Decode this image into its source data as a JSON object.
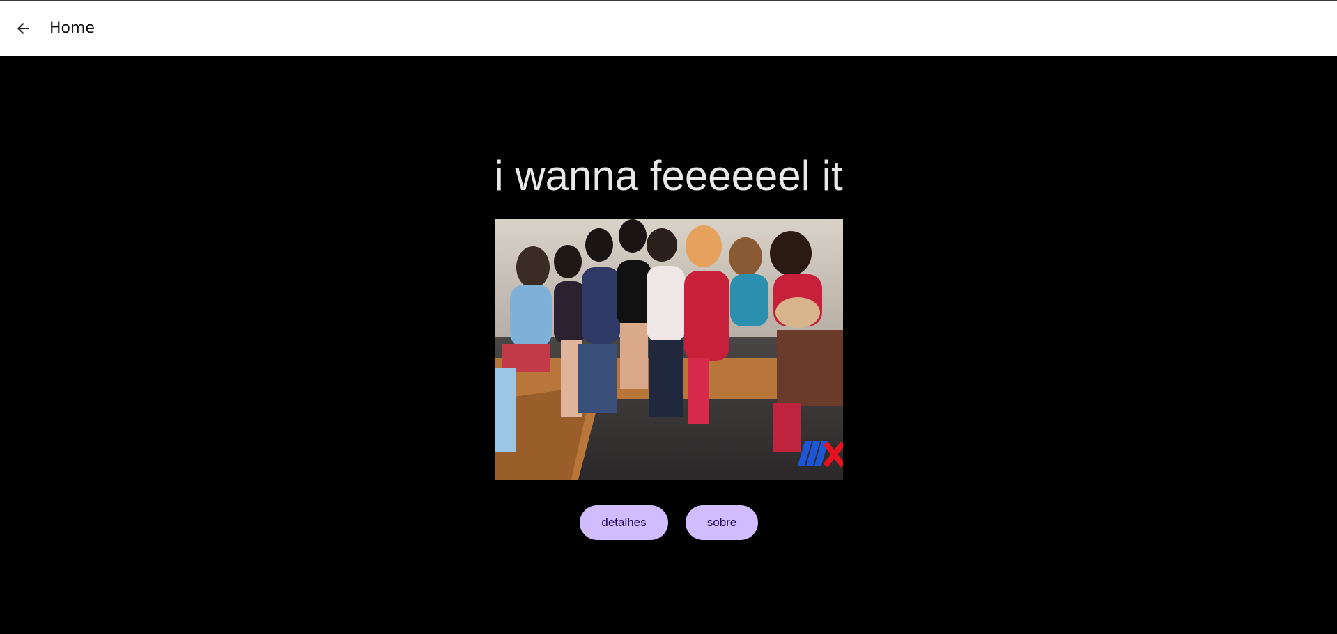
{
  "app_bar": {
    "title": "Home",
    "back_icon": "arrow-left-icon"
  },
  "main": {
    "headline": "i wanna feeeeeel it",
    "image_alt": "group photo of young cast sitting on a couch",
    "buttons": [
      {
        "label": "detalhes"
      },
      {
        "label": "sobre"
      }
    ]
  },
  "colors": {
    "app_bar_bg": "#ffffff",
    "page_bg": "#000000",
    "headline": "#e8e8e8",
    "button_bg": "#d0bcff",
    "button_text": "#21005d"
  }
}
